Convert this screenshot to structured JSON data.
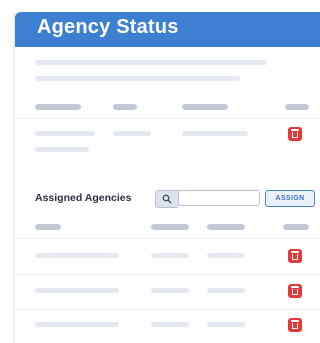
{
  "header": {
    "title": "Agency Status"
  },
  "assigned_section": {
    "label": "Assigned Agencies",
    "search": {
      "value": "",
      "placeholder": ""
    },
    "assign_label": "ASSIGN"
  },
  "icons": {
    "delete": "trash-icon",
    "search": "search-icon"
  },
  "colors": {
    "header": "#3d7fd0",
    "delete": "#e03a3a",
    "assign_border": "#4a86d0",
    "placeholder_bar": "#e4e9f2",
    "placeholder_header_bar": "#c2c9d5"
  }
}
